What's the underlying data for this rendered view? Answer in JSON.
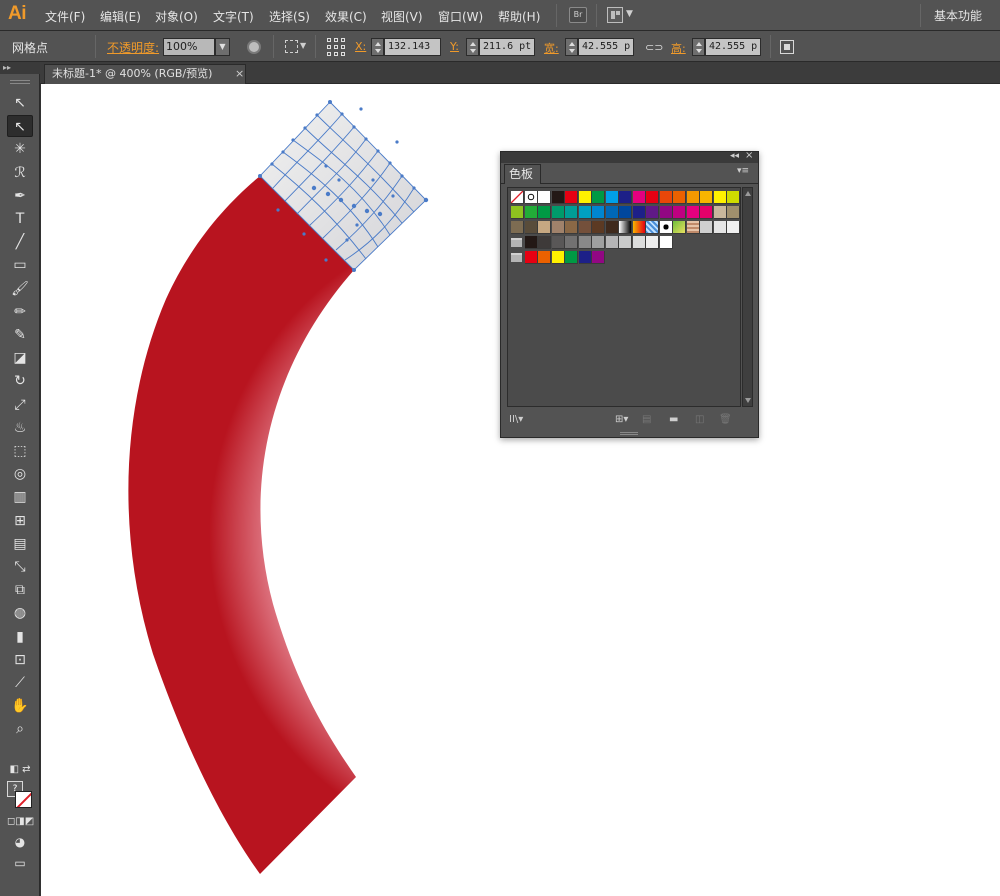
{
  "app": {
    "logo": "Ai",
    "workspace": "基本功能"
  },
  "menu": [
    "文件(F)",
    "编辑(E)",
    "对象(O)",
    "文字(T)",
    "选择(S)",
    "效果(C)",
    "视图(V)",
    "窗口(W)",
    "帮助(H)"
  ],
  "menubar_buttons": {
    "bridge": "Br"
  },
  "control": {
    "selection_type": "网格点",
    "opacity_label": "不透明度:",
    "opacity_value": "100%",
    "x_label": "X:",
    "x_value": "132.143",
    "y_label": "Y:",
    "y_value": "211.6 pt",
    "w_label": "宽:",
    "w_value": "42.555 p",
    "h_label": "高:",
    "h_value": "42.555 p"
  },
  "document_tab": {
    "title": "未标题-1* @ 400% (RGB/预览)",
    "close": "×"
  },
  "tools": [
    {
      "name": "selection-tool",
      "glyph": "↖",
      "active": false
    },
    {
      "name": "direct-selection-tool",
      "glyph": "↖",
      "active": true
    },
    {
      "name": "magic-wand-tool",
      "glyph": "✳",
      "active": false
    },
    {
      "name": "lasso-tool",
      "glyph": "ℛ",
      "active": false
    },
    {
      "name": "pen-tool",
      "glyph": "✒",
      "active": false
    },
    {
      "name": "type-tool",
      "glyph": "T",
      "active": false
    },
    {
      "name": "line-tool",
      "glyph": "╱",
      "active": false
    },
    {
      "name": "rectangle-tool",
      "glyph": "▭",
      "active": false
    },
    {
      "name": "paintbrush-tool",
      "glyph": "🖌",
      "active": false
    },
    {
      "name": "pencil-tool",
      "glyph": "✏",
      "active": false
    },
    {
      "name": "blob-brush-tool",
      "glyph": "✎",
      "active": false
    },
    {
      "name": "eraser-tool",
      "glyph": "◪",
      "active": false
    },
    {
      "name": "rotate-tool",
      "glyph": "↻",
      "active": false
    },
    {
      "name": "scale-tool",
      "glyph": "⤢",
      "active": false
    },
    {
      "name": "warp-tool",
      "glyph": "♨",
      "active": false
    },
    {
      "name": "free-transform-tool",
      "glyph": "⬚",
      "active": false
    },
    {
      "name": "shape-builder-tool",
      "glyph": "◎",
      "active": false
    },
    {
      "name": "perspective-grid-tool",
      "glyph": "▥",
      "active": false
    },
    {
      "name": "mesh-tool",
      "glyph": "⊞",
      "active": false
    },
    {
      "name": "gradient-tool",
      "glyph": "▤",
      "active": false
    },
    {
      "name": "eyedropper-tool",
      "glyph": "⤡",
      "active": false
    },
    {
      "name": "blend-tool",
      "glyph": "⧉",
      "active": false
    },
    {
      "name": "symbol-sprayer-tool",
      "glyph": "◍",
      "active": false
    },
    {
      "name": "column-graph-tool",
      "glyph": "▮",
      "active": false
    },
    {
      "name": "artboard-tool",
      "glyph": "⊡",
      "active": false
    },
    {
      "name": "slice-tool",
      "glyph": "⟋",
      "active": false
    },
    {
      "name": "hand-tool",
      "glyph": "✋",
      "active": false
    },
    {
      "name": "zoom-tool",
      "glyph": "⌕",
      "active": false
    }
  ],
  "fill_stroke": {
    "fill_mark": "?"
  },
  "swatches_panel": {
    "title": "色板",
    "collapse": "◂◂",
    "close": "×",
    "menu": "▾≡",
    "rows": [
      [
        "none",
        "registration",
        "#ffffff",
        "#231815",
        "#e60012",
        "#fff100",
        "#009944",
        "#00a0e9",
        "#1d2088",
        "#e4007f",
        "#e60012",
        "#e94709",
        "#eb6100",
        "#f39800",
        "#f8b500",
        "#fff100",
        "#cfdb00"
      ],
      [
        "#8fc31f",
        "#22ac38",
        "#009944",
        "#009b6b",
        "#009e96",
        "#00a0c1",
        "#0086d1",
        "#0068b7",
        "#00479d",
        "#1d2088",
        "#601986",
        "#920783",
        "#be0081",
        "#e4007f",
        "#e5006a",
        "#c9b79c",
        "#a08f6d"
      ],
      [
        "#7d6c52",
        "#594c3a",
        "#c7a882",
        "#a0826b",
        "#8a6846",
        "#74503b",
        "#5c3a23",
        "#3f2a1d",
        "gradient-bw",
        "gradient-orange",
        "pattern-blue",
        "pattern-dots",
        "pattern-leaf",
        "pattern-tex",
        "#d0d0d0",
        "#e5e5e5",
        "#f0f0f0"
      ],
      [
        "folder",
        "#231815",
        "#3e3a39",
        "#595757",
        "#727171",
        "#898989",
        "#9fa0a0",
        "#b5b5b6",
        "#c9caca",
        "#dcdddd",
        "#efefef",
        "#ffffff"
      ],
      [
        "folder",
        "#e60012",
        "#eb6100",
        "#fff100",
        "#009944",
        "#1d2088",
        "#920783"
      ]
    ]
  },
  "colors": {
    "red_dark": "#b8141f",
    "red_light": "#dd727e",
    "mesh_blue": "#4a7bc8",
    "accent_orange": "#f09a2a"
  }
}
